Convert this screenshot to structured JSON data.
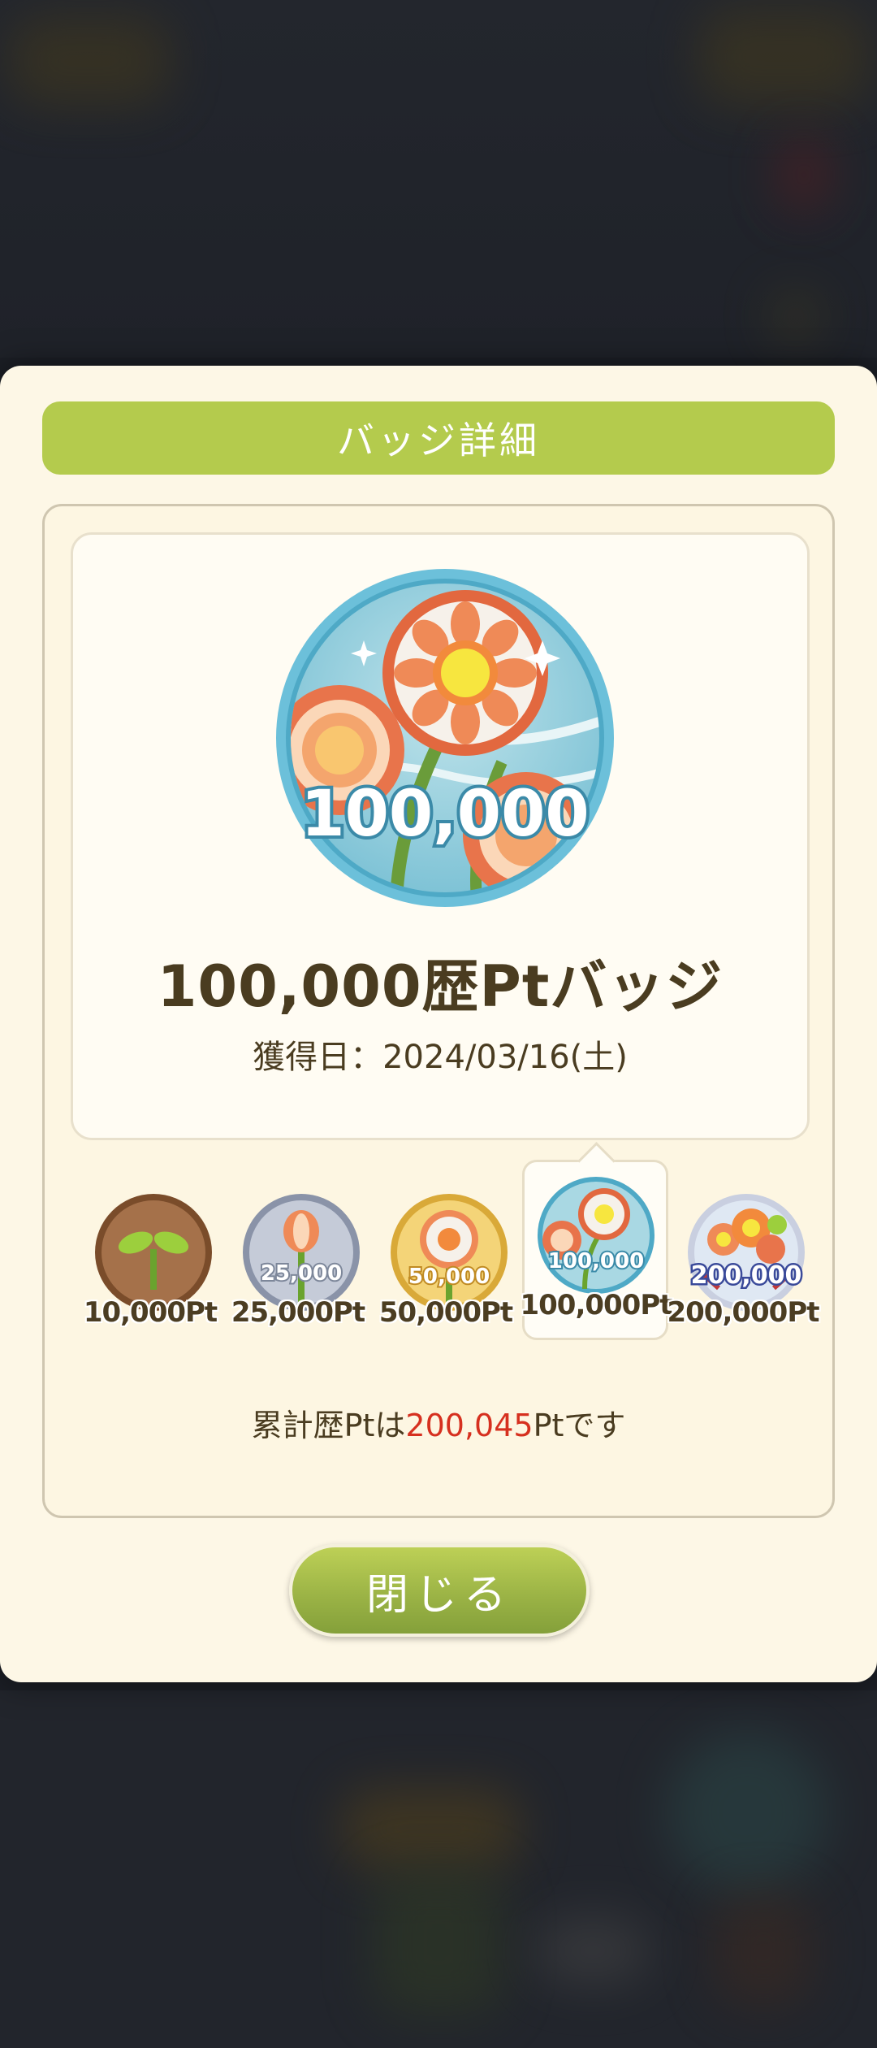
{
  "modal": {
    "title": "バッジ詳細",
    "featured": {
      "badge_number": "100,000",
      "name": "100,000歴Ptバッジ",
      "acquired_label": "獲得日：",
      "acquired_date": "2024/03/16(土)"
    },
    "badges": [
      {
        "label": "10,000Pt",
        "icon": "sprout-badge-icon",
        "selected": false
      },
      {
        "label": "25,000Pt",
        "icon": "bud-badge-icon",
        "badge_number": "25,000",
        "selected": false
      },
      {
        "label": "50,000Pt",
        "icon": "flower-badge-icon",
        "badge_number": "50,000",
        "selected": false
      },
      {
        "label": "100,000Pt",
        "icon": "flowers-badge-icon",
        "badge_number": "100,000",
        "selected": true
      },
      {
        "label": "200,000Pt",
        "icon": "bouquet-badge-icon",
        "badge_number": "200,000",
        "selected": false
      }
    ],
    "total": {
      "prefix": "累計歴Ptは",
      "value": "200,045",
      "suffix": "Ptです"
    },
    "close_label": "閉じる"
  },
  "colors": {
    "header": "#b4cb4d",
    "modal_bg": "#fdf7e6",
    "highlight": "#d6301f",
    "text": "#4a3c20"
  }
}
